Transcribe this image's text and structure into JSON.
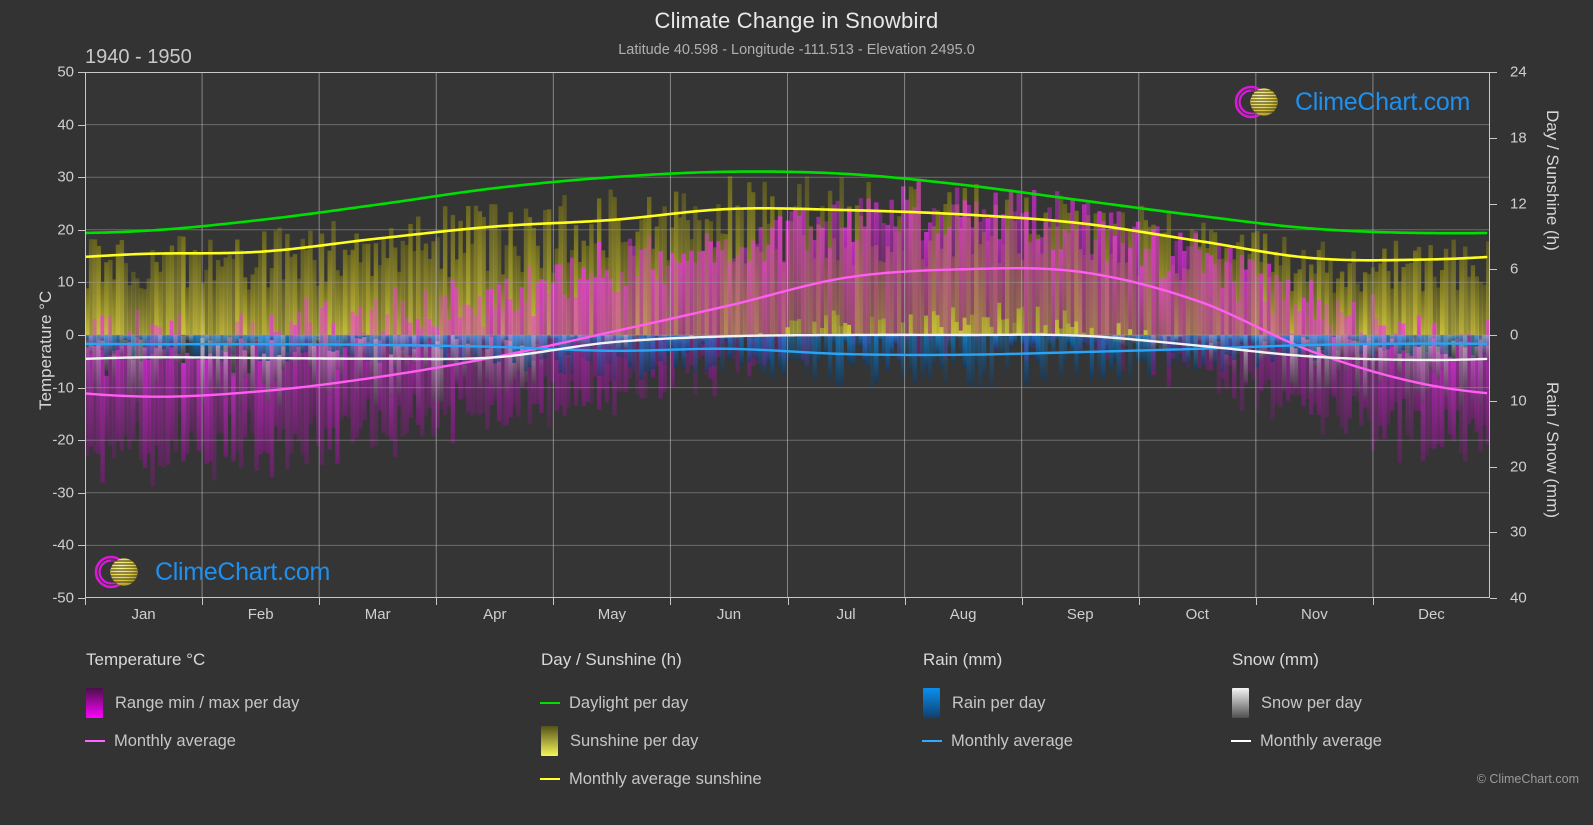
{
  "header": {
    "title": "Climate Change in Snowbird",
    "subtitle": "Latitude 40.598 - Longitude -111.513 - Elevation 2495.0",
    "period": "1940 - 1950"
  },
  "axes": {
    "left_title": "Temperature °C",
    "left_ticks": [
      50,
      40,
      30,
      20,
      10,
      0,
      -10,
      -20,
      -30,
      -40,
      -50
    ],
    "right_top_title": "Day / Sunshine (h)",
    "right_top_ticks": [
      24,
      18,
      12,
      6,
      0
    ],
    "right_bottom_title": "Rain / Snow (mm)",
    "right_bottom_ticks": [
      0,
      10,
      20,
      30,
      40
    ],
    "x_ticks": [
      "Jan",
      "Feb",
      "Mar",
      "Apr",
      "May",
      "Jun",
      "Jul",
      "Aug",
      "Sep",
      "Oct",
      "Nov",
      "Dec"
    ]
  },
  "legend": {
    "temperature": {
      "heading": "Temperature °C",
      "items": [
        {
          "label": "Range min / max per day",
          "marker": "swatch",
          "color": "#ff00ff"
        },
        {
          "label": "Monthly average",
          "marker": "line",
          "color": "#ff66ff"
        }
      ]
    },
    "daysun": {
      "heading": "Day / Sunshine (h)",
      "items": [
        {
          "label": "Daylight per day",
          "marker": "line",
          "color": "#00e000"
        },
        {
          "label": "Sunshine per day",
          "marker": "swatch",
          "color": "#f0f040"
        },
        {
          "label": "Monthly average sunshine",
          "marker": "line",
          "color": "#ffff33"
        }
      ]
    },
    "rain": {
      "heading": "Rain (mm)",
      "items": [
        {
          "label": "Rain per day",
          "marker": "swatch",
          "color": "#0a8ff0"
        },
        {
          "label": "Monthly average",
          "marker": "line",
          "color": "#33aaff"
        }
      ]
    },
    "snow": {
      "heading": "Snow (mm)",
      "items": [
        {
          "label": "Snow per day",
          "marker": "swatch",
          "color": "#e8e8e8"
        },
        {
          "label": "Monthly average",
          "marker": "line",
          "color": "#ffffff"
        }
      ]
    }
  },
  "branding": {
    "logo_text": "ClimeChart.com",
    "copyright": "© ClimeChart.com"
  },
  "chart_data": {
    "type": "area",
    "title": "Climate Change in Snowbird",
    "subtitle": "Latitude 40.598 - Longitude -111.513 - Elevation 2495.0",
    "period": "1940 - 1950",
    "xlabel": "",
    "ylabel": "Temperature °C",
    "ylim": [
      -50,
      50
    ],
    "y2lim_day_sunshine": [
      0,
      24
    ],
    "y2lim_rain_snow": [
      0,
      40
    ],
    "grid": true,
    "legend_position": "below",
    "categories": [
      "Jan",
      "Feb",
      "Mar",
      "Apr",
      "May",
      "Jun",
      "Jul",
      "Aug",
      "Sep",
      "Oct",
      "Nov",
      "Dec"
    ],
    "series": [
      {
        "name": "Daylight per day (h)",
        "color": "#00e000",
        "unit": "h",
        "values": [
          9.5,
          10.5,
          11.9,
          13.4,
          14.4,
          14.9,
          14.7,
          13.7,
          12.3,
          10.9,
          9.7,
          9.3
        ]
      },
      {
        "name": "Monthly average sunshine (h)",
        "color": "#ffff33",
        "unit": "h",
        "values": [
          7.4,
          7.6,
          8.8,
          9.9,
          10.5,
          11.5,
          11.4,
          11.0,
          10.2,
          8.6,
          7.0,
          6.9
        ]
      },
      {
        "name": "Monthly average temperature (°C)",
        "color": "#ff66ff",
        "unit": "°C",
        "values": [
          -11.7,
          -10.7,
          -8.0,
          -4.2,
          0.6,
          5.6,
          10.9,
          12.5,
          12.0,
          6.5,
          -3.3,
          -9.6
        ]
      },
      {
        "name": "Monthly average rain (mm)",
        "color": "#33aaff",
        "unit": "mm",
        "values": [
          1.4,
          1.4,
          1.5,
          1.8,
          2.4,
          2.1,
          2.9,
          3.0,
          2.6,
          2.1,
          1.5,
          1.3
        ]
      },
      {
        "name": "Monthly average snow (mm)",
        "color": "#ffffff",
        "unit": "mm",
        "values": [
          3.4,
          3.5,
          3.6,
          3.4,
          1.1,
          0.2,
          0.0,
          0.0,
          0.1,
          1.6,
          3.3,
          3.8
        ]
      },
      {
        "name": "Daily temperature range max (°C)",
        "color": "#ff00ff",
        "unit": "°C",
        "values": [
          -2.0,
          -1.0,
          2.0,
          6.0,
          11.0,
          17.0,
          22.0,
          23.0,
          21.0,
          14.0,
          4.5,
          -1.0
        ]
      },
      {
        "name": "Daily temperature range min (°C)",
        "color": "#aa00aa",
        "unit": "°C",
        "values": [
          -21.0,
          -20.0,
          -17.5,
          -14.0,
          -9.0,
          -4.0,
          1.0,
          2.0,
          1.0,
          -6.0,
          -13.0,
          -19.0
        ]
      }
    ]
  }
}
